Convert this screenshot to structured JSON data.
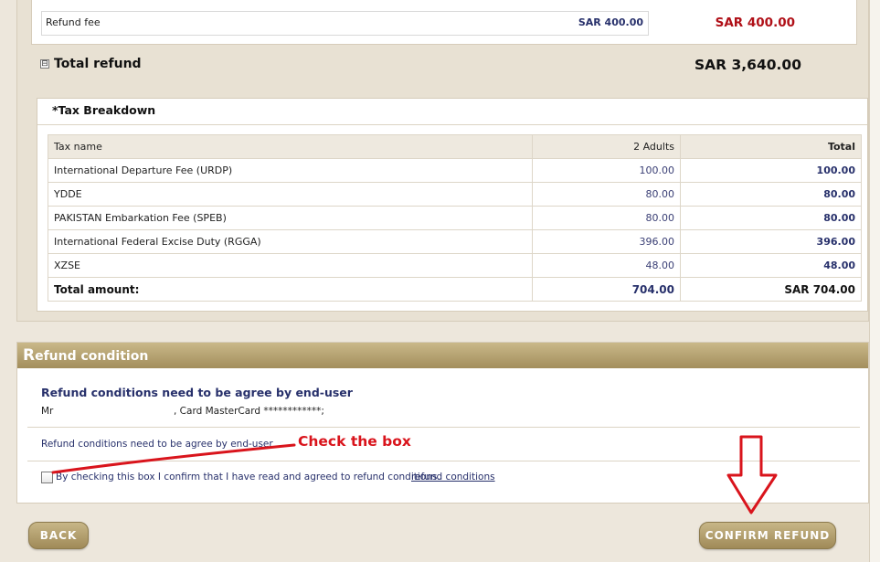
{
  "refund_fee": {
    "label": "Refund fee",
    "value": "SAR 400.00",
    "total": "SAR 400.00"
  },
  "total_refund": {
    "toggle": "⊟",
    "label": "Total refund",
    "value": "SAR 3,640.00"
  },
  "tax_breakdown": {
    "title": "*Tax Breakdown",
    "columns": [
      "Tax name",
      "2 Adults",
      "Total"
    ],
    "rows": [
      {
        "name": "International Departure Fee (URDP)",
        "adults": "100.00",
        "total": "100.00"
      },
      {
        "name": "YDDE",
        "adults": "80.00",
        "total": "80.00"
      },
      {
        "name": "PAKISTAN Embarkation Fee (SPEB)",
        "adults": "80.00",
        "total": "80.00"
      },
      {
        "name": "International Federal Excise Duty (RGGA)",
        "adults": "396.00",
        "total": "396.00"
      },
      {
        "name": "XZSE",
        "adults": "48.00",
        "total": "48.00"
      }
    ],
    "sum": {
      "name": "Total amount:",
      "adults": "704.00",
      "total": "SAR 704.00"
    }
  },
  "refund_condition": {
    "header_first": "R",
    "header_rest": "efund condition",
    "heading": "Refund conditions need to be agree by end-user",
    "passenger_prefix": "Mr",
    "card_info": ", Card MasterCard ************;",
    "text": "Refund conditions need to be agree by end-user",
    "checkbox_label": "By checking this box I confirm that I have read and agreed to refund conditions.",
    "link_label": "refund conditions",
    "checked": false
  },
  "annotation": {
    "label": "Check the box",
    "color": "#d9141c"
  },
  "buttons": {
    "back": "BACK",
    "confirm": "CONFIRM REFUND"
  },
  "colors": {
    "accent_gold": "#b09a66",
    "price_red": "#b01018",
    "text_navy": "#27306b"
  }
}
